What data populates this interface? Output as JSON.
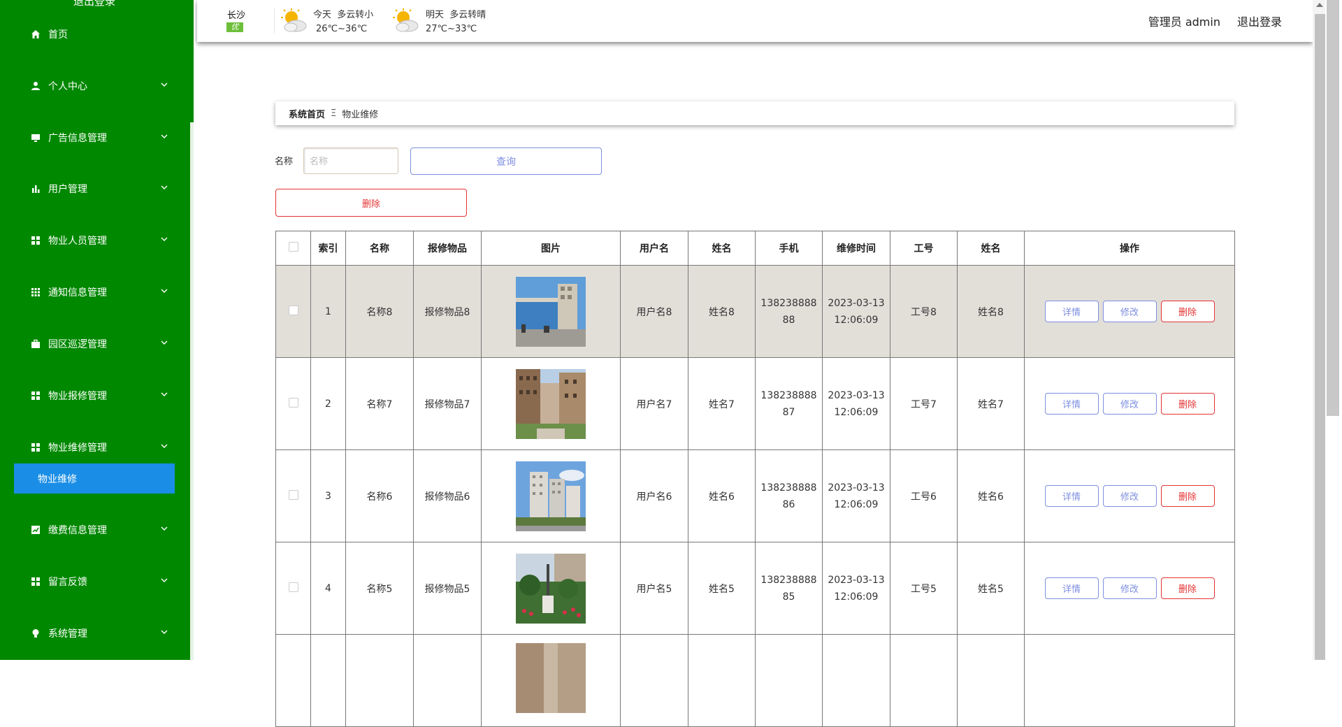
{
  "sidebar": {
    "logout_top": "退出登录",
    "items": [
      {
        "label": "首页",
        "icon": "home-icon"
      },
      {
        "label": "个人中心",
        "icon": "user-icon"
      },
      {
        "label": "广告信息管理",
        "icon": "monitor-icon"
      },
      {
        "label": "用户管理",
        "icon": "bar-chart-icon"
      },
      {
        "label": "物业人员管理",
        "icon": "grid-icon"
      },
      {
        "label": "通知信息管理",
        "icon": "apps-icon"
      },
      {
        "label": "园区巡逻管理",
        "icon": "briefcase-icon"
      },
      {
        "label": "物业报修管理",
        "icon": "grid-icon"
      },
      {
        "label": "物业维修管理",
        "icon": "grid-icon"
      },
      {
        "label": "缴费信息管理",
        "icon": "trend-icon"
      },
      {
        "label": "留言反馈",
        "icon": "grid-icon"
      },
      {
        "label": "系统管理",
        "icon": "bulb-icon"
      }
    ],
    "active_sub": "物业维修"
  },
  "header": {
    "city": "长沙",
    "aqi": "优",
    "today": {
      "label": "今天",
      "desc": "多云转小",
      "temp": "26℃~36℃"
    },
    "tomorrow": {
      "label": "明天",
      "desc": "多云转晴",
      "temp": "27℃~33℃"
    },
    "user": "管理员 admin",
    "logout": "退出登录"
  },
  "breadcrumb": {
    "home": "系统首页",
    "separator": "Ξ",
    "current": "物业维修"
  },
  "search": {
    "label": "名称",
    "placeholder": "名称",
    "button": "查询"
  },
  "delete_button": "删除",
  "table": {
    "headers": [
      "索引",
      "名称",
      "报修物品",
      "图片",
      "用户名",
      "姓名",
      "手机",
      "维修时间",
      "工号",
      "姓名",
      "操作"
    ],
    "rows": [
      {
        "index": "1",
        "name": "名称8",
        "item": "报修物品8",
        "username": "用户名8",
        "realname": "姓名8",
        "phone": "13823888888",
        "time": "2023-03-13 12:06:09",
        "workno": "工号8",
        "staff": "姓名8"
      },
      {
        "index": "2",
        "name": "名称7",
        "item": "报修物品7",
        "username": "用户名7",
        "realname": "姓名7",
        "phone": "13823888887",
        "time": "2023-03-13 12:06:09",
        "workno": "工号7",
        "staff": "姓名7"
      },
      {
        "index": "3",
        "name": "名称6",
        "item": "报修物品6",
        "username": "用户名6",
        "realname": "姓名6",
        "phone": "13823888886",
        "time": "2023-03-13 12:06:09",
        "workno": "工号6",
        "staff": "姓名6"
      },
      {
        "index": "4",
        "name": "名称5",
        "item": "报修物品5",
        "username": "用户名5",
        "realname": "姓名5",
        "phone": "13823888885",
        "time": "2023-03-13 12:06:09",
        "workno": "工号5",
        "staff": "姓名5"
      }
    ],
    "actions": {
      "detail": "详情",
      "edit": "修改",
      "delete": "删除"
    }
  },
  "colors": {
    "sidebar": "#008800",
    "active": "#1a8ee6",
    "primary": "#7e8fe0",
    "danger": "#e53333"
  }
}
